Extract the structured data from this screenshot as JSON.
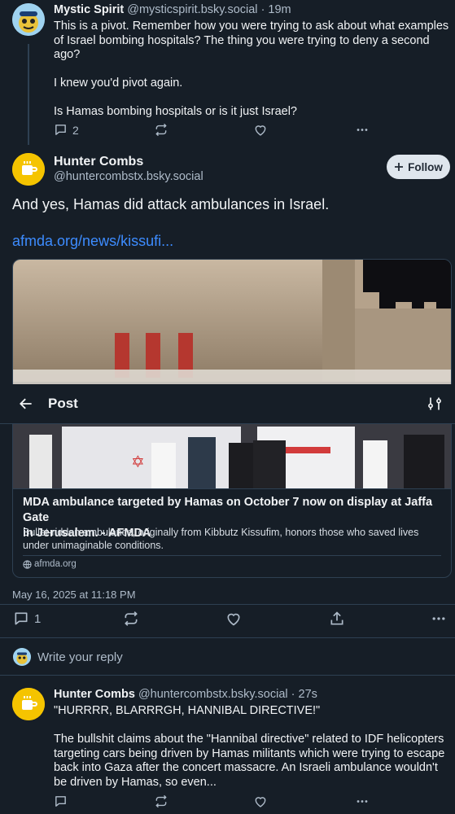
{
  "parent_post": {
    "display_name": "Mystic Spirit",
    "handle": "@mysticspirit.bsky.social",
    "time": "· 19m",
    "text_lines": [
      "This is a pivot. Remember how you were trying to ask about what examples",
      "of Israel bombing hospitals? The thing you were trying to deny a second",
      "ago?",
      "",
      "I knew you'd pivot again.",
      "",
      "Is Hamas bombing hospitals or is it just Israel?"
    ],
    "reply_count": "2",
    "icons": [
      "reply-icon",
      "repost-icon",
      "like-icon",
      "more-icon"
    ]
  },
  "main_post": {
    "display_name": "Hunter Combs",
    "handle": "@huntercombstx.bsky.social",
    "follow_label": "Follow",
    "text": "And yes, Hamas did attack ambulances in Israel.",
    "link": "afmda.org/news/kissufi...",
    "embed": {
      "title_line1": "MDA ambulance targeted by Hamas on October 7 now on display at Jaffa Gate",
      "title_line2": "in Jerusalem. - AFMDA",
      "desc_line1": "Bullet-ridden ambulance, originally from Kibbutz Kissufim, honors those who saved lives",
      "desc_line2": "under unimaginable conditions.",
      "domain": "afmda.org"
    },
    "timestamp": "May 16, 2025 at 11:18 PM",
    "reply_count": "1"
  },
  "header": {
    "title": "Post",
    "back_icon": "back-arrow-icon",
    "settings_icon": "sliders-icon"
  },
  "reply_composer": {
    "placeholder": "Write your reply"
  },
  "reply_post": {
    "display_name": "Hunter Combs",
    "handle": "@huntercombstx.bsky.social",
    "time": "· 27s",
    "text_lines": [
      "\"HURRRR, BLARRRGH, HANNIBAL DIRECTIVE!\"",
      "",
      "The bullshit claims about the \"Hannibal directive\" related to IDF helicopters",
      "targeting cars being driven by Hamas militants which were trying to escape",
      "back into Gaza after the concert massacre. An Israeli ambulance wouldn't",
      "be driven by Hamas, so even..."
    ]
  },
  "colors": {
    "background": "#161e27",
    "link": "#3d8cff",
    "muted": "#aebbc9",
    "border": "#2e4052",
    "avatar_yellow": "#f5c400"
  }
}
